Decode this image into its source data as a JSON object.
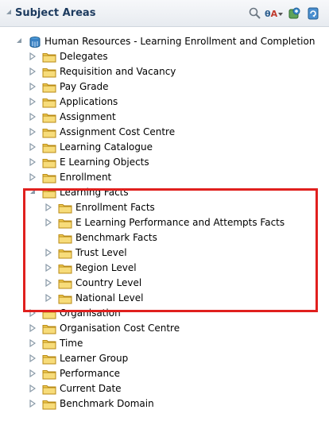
{
  "header": {
    "title": "Subject Areas",
    "icons": [
      "search-icon",
      "filter-icon",
      "add-subject-area-icon",
      "refresh-icon"
    ]
  },
  "root": {
    "label": "Human Resources - Learning Enrollment and Completion",
    "icon": "subject-area-icon",
    "state": "expanded"
  },
  "folders": [
    {
      "label": "Delegates",
      "state": "collapsed",
      "level": 1
    },
    {
      "label": "Requisition and Vacancy",
      "state": "collapsed",
      "level": 1
    },
    {
      "label": "Pay Grade",
      "state": "collapsed",
      "level": 1
    },
    {
      "label": "Applications",
      "state": "collapsed",
      "level": 1
    },
    {
      "label": "Assignment",
      "state": "collapsed",
      "level": 1
    },
    {
      "label": "Assignment Cost Centre",
      "state": "collapsed",
      "level": 1
    },
    {
      "label": "Learning Catalogue",
      "state": "collapsed",
      "level": 1
    },
    {
      "label": "E Learning Objects",
      "state": "collapsed",
      "level": 1
    },
    {
      "label": "Enrollment",
      "state": "collapsed",
      "level": 1
    },
    {
      "label": "Learning Facts",
      "state": "expanded",
      "level": 1
    },
    {
      "label": "Enrollment Facts",
      "state": "collapsed",
      "level": 2
    },
    {
      "label": "E Learning Performance and Attempts Facts",
      "state": "collapsed",
      "level": 2
    },
    {
      "label": "Benchmark Facts",
      "state": "leaf",
      "level": 2
    },
    {
      "label": "Trust Level",
      "state": "collapsed",
      "level": 2
    },
    {
      "label": "Region Level",
      "state": "collapsed",
      "level": 2
    },
    {
      "label": "Country Level",
      "state": "collapsed",
      "level": 2
    },
    {
      "label": "National Level",
      "state": "collapsed",
      "level": 2
    },
    {
      "label": "Organisation",
      "state": "collapsed",
      "level": 1
    },
    {
      "label": "Organisation Cost Centre",
      "state": "collapsed",
      "level": 1
    },
    {
      "label": "Time",
      "state": "collapsed",
      "level": 1
    },
    {
      "label": "Learner Group",
      "state": "collapsed",
      "level": 1
    },
    {
      "label": "Performance",
      "state": "collapsed",
      "level": 1
    },
    {
      "label": "Current Date",
      "state": "collapsed",
      "level": 1
    },
    {
      "label": "Benchmark Domain",
      "state": "collapsed",
      "level": 1
    }
  ],
  "colors": {
    "header_title": "#1c3a5e",
    "highlight_border": "#e0201e",
    "folder_fill": "#f3cd55",
    "folder_stroke": "#b88a14",
    "expander": "#8a9aa8"
  }
}
